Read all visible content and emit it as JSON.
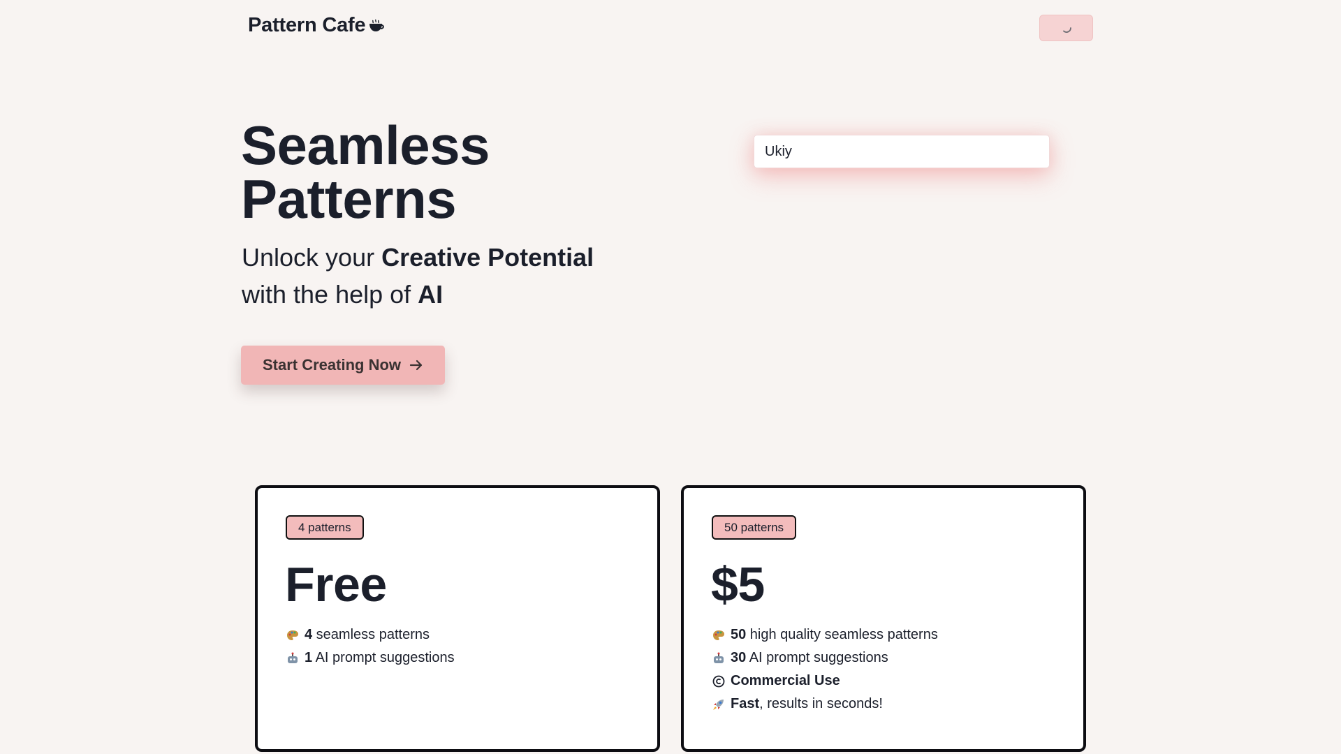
{
  "header": {
    "logo_text": "Pattern Cafe",
    "logo_icon": "coffee-cup-icon",
    "action_button_icon": "loading-spinner-icon"
  },
  "hero": {
    "title_line1": "Seamless",
    "title_line2": "Patterns",
    "subtitle_part1": "Unlock your ",
    "subtitle_bold1": "Creative Potential",
    "subtitle_part2": "with the help of ",
    "subtitle_bold2": "AI",
    "cta_label": "Start Creating Now",
    "cta_icon": "arrow-right-icon"
  },
  "prompt": {
    "value": "Ukiy"
  },
  "plans": [
    {
      "badge": "4 patterns",
      "price": "Free",
      "features": [
        {
          "icon": "palette-icon",
          "bold": "4",
          "text": " seamless patterns"
        },
        {
          "icon": "robot-icon",
          "bold": "1",
          "text": " AI prompt suggestions"
        }
      ]
    },
    {
      "badge": "50 patterns",
      "price": "$5",
      "features": [
        {
          "icon": "palette-icon",
          "bold": "50",
          "text": " high quality seamless patterns"
        },
        {
          "icon": "robot-icon",
          "bold": "30",
          "text": " AI prompt suggestions"
        },
        {
          "icon": "copyright-icon",
          "bold": "Commercial Use",
          "text": ""
        },
        {
          "icon": "rocket-icon",
          "bold": "Fast",
          "text": ", results in seconds!"
        }
      ]
    }
  ],
  "colors": {
    "background": "#f8f4f2",
    "accent_pink": "#f1b6b6",
    "text_dark": "#1b1f2b",
    "card_border": "#0d0d12"
  }
}
